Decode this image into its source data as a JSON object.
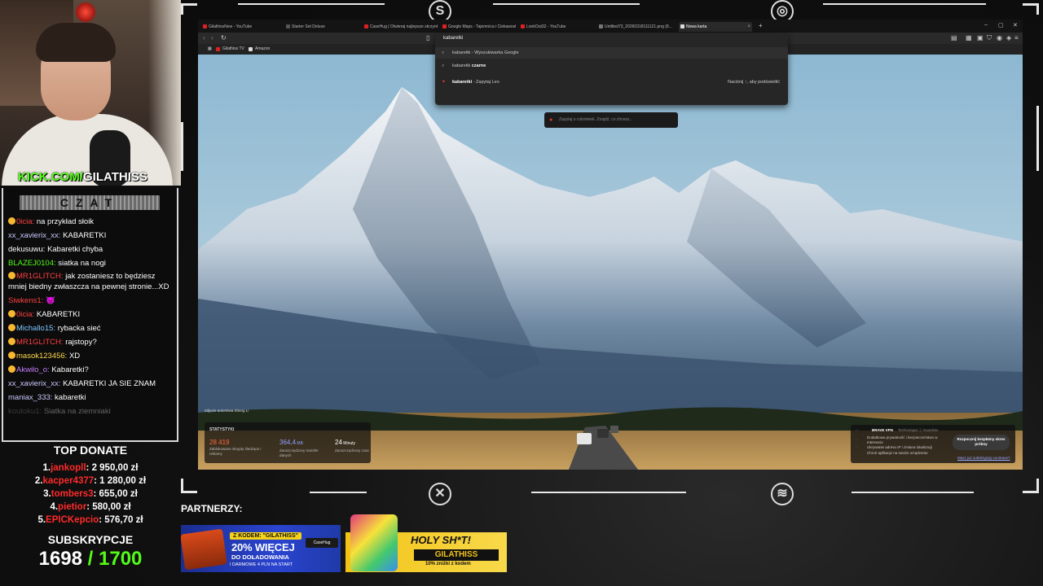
{
  "stream": {
    "kick_url_green": "KICK.COM/",
    "kick_url_white": "GILATHISS",
    "chat_title": "CZAT",
    "partners_label": "PARTNERZY:"
  },
  "chat": [
    {
      "user": "0icia:",
      "msg": "na przykład słoik",
      "color": "#ff4040",
      "badge": true
    },
    {
      "user": "xx_xavierix_xx:",
      "msg": "KABARETKI",
      "color": "#c8c8ff",
      "badge": false
    },
    {
      "user": "dekusuwu:",
      "msg": "Kabaretki chyba",
      "color": "#ffffff",
      "badge": false
    },
    {
      "user": "BLAZEJ0104:",
      "msg": "siatka na nogi",
      "color": "#53fc18",
      "badge": false
    },
    {
      "user": "MR1GLITCH:",
      "msg": "jak zostaniesz to będziesz mniej biedny zwłaszcza na pewnej stronie...XD",
      "color": "#ff4040",
      "badge": true,
      "multi": true
    },
    {
      "user": "Siwkens1:",
      "msg": "",
      "color": "#ff4040",
      "badge": false,
      "emote": "😈"
    },
    {
      "user": "0icia:",
      "msg": "KABARETKI",
      "color": "#ff4040",
      "badge": true
    },
    {
      "user": "Michallo15:",
      "msg": "rybacka sieć",
      "color": "#7ec8ff",
      "badge": true
    },
    {
      "user": "MR1GLITCH:",
      "msg": "rajstopy?",
      "color": "#ff4040",
      "badge": true
    },
    {
      "user": "masok123456:",
      "msg": "XD",
      "color": "#ffd84a",
      "badge": true
    },
    {
      "user": "Akwilo_o:",
      "msg": "Kabaretki?",
      "color": "#c77dff",
      "badge": true
    },
    {
      "user": "xx_xavierix_xx:",
      "msg": "KABARETKI JA SIE ZNAM",
      "color": "#c8c8ff",
      "badge": false
    },
    {
      "user": "maniax_333:",
      "msg": "kabaretki",
      "color": "#c8c8ff",
      "badge": false
    },
    {
      "user": "koutoku1:",
      "msg": "Siatka na ziemniaki",
      "color": "#8a8a8a",
      "badge": false,
      "faded": true
    }
  ],
  "top_donate": {
    "title": "TOP DONATE",
    "entries": [
      {
        "rank": "1.",
        "name": "jankopll",
        "amount": ": 2 950,00 zł"
      },
      {
        "rank": "2.",
        "name": "kacper4377",
        "amount": ": 1 280,00 zł"
      },
      {
        "rank": "3.",
        "name": "tombers3",
        "amount": ": 655,00 zł"
      },
      {
        "rank": "4.",
        "name": "pietior",
        "amount": ": 580,00 zł"
      },
      {
        "rank": "5.",
        "name": "EPICKepcio",
        "amount": ": 576,70 zł"
      }
    ]
  },
  "subs": {
    "label": "SUBSKRYPCJE",
    "current": "1698",
    "goal": "/ 1700"
  },
  "browser": {
    "tabs": [
      {
        "title": "GilathissNew - YouTube",
        "favicon": "#e02020"
      },
      {
        "title": "Starter Set Deluxe",
        "favicon": "#555555"
      },
      {
        "title": "CaseHug | Otwieraj najlepsze skrzynki",
        "favicon": "#e02020"
      },
      {
        "title": "Google Maps - Tajemnica i Ciekawostki",
        "favicon": "#e02020"
      },
      {
        "title": "LookOut32 - YouTube",
        "favicon": "#e02020"
      },
      {
        "title": "Untitled73_20260318111121.png (8...",
        "favicon": "#777777"
      },
      {
        "title": "Nowa karta",
        "favicon": "#dddddd",
        "active": true
      }
    ],
    "bookmarks": [
      {
        "label": "Gilathiss TV"
      },
      {
        "label": "Amazon"
      }
    ],
    "omnibox": {
      "query": "kabaretki",
      "suggestions": [
        {
          "prefix": "kabaretki",
          "suffix": " - Wyszukiwarka Google",
          "icon": "⌕",
          "highlight": true
        },
        {
          "prefix": "kabaretki ",
          "suffix": "czarne",
          "icon": "⌕"
        },
        {
          "prefix": "kabaretki",
          "suffix": " - Zapytaj Leo",
          "icon": "✦",
          "right": "Naciśnij ↑, aby podświetlić"
        }
      ]
    },
    "leo_placeholder": "Zapytaj o cokolwiek. Znajdź, co chcesz...",
    "photo_credit": "Zdjęcie autorstwa Sheng Li",
    "stats": {
      "title": "STATYSTYKI",
      "items": [
        {
          "value": "28 419",
          "unit": "",
          "label": "Zablokowane skrypty śledzące i reklamy",
          "color": "#ff6a3d"
        },
        {
          "value": "364,4",
          "unit": " MB",
          "label": "Zaoszczędzony transfer danych",
          "color": "#8fa2ff"
        },
        {
          "value": "24",
          "unit": " Minuty",
          "label": "Zaoszczędzony czas",
          "color": "#ffffff"
        }
      ]
    },
    "vpn": {
      "title": "BRAVE VPN",
      "subtitle": "Technologia ⓘ Guardian",
      "bullets": [
        "Dodatkowa prywatność i bezpieczeństwo w Internecie",
        "Ukrywanie adresu IP i zmiana lokalizacji",
        "Chroń aplikacje na swoim urządzeniu"
      ],
      "button": "Rozpocznij bezpłatny okres próbny",
      "link": "Masz już subskrypcję na Brave?"
    }
  },
  "banners": {
    "casehug": {
      "code": "Z KODEM: \"GILATHISS\"",
      "big": "20% WIĘCEJ",
      "sub": "DO DOŁADOWANIA",
      "sub2": "I DARMOWE 4 PLN NA START",
      "logo": "CaseHug"
    },
    "holy": {
      "headline": "HOLY SH*T!",
      "code": "GILATHISS",
      "sub": "10% zniżki z kodem"
    }
  }
}
